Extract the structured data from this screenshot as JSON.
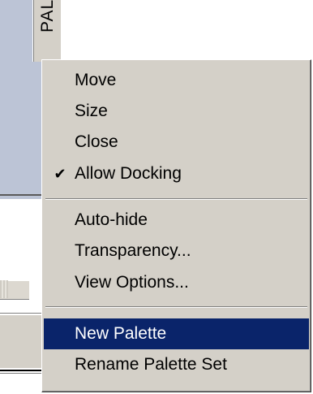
{
  "palette": {
    "title": "PALI"
  },
  "menu": {
    "items": [
      {
        "label": "Move"
      },
      {
        "label": "Size"
      },
      {
        "label": "Close"
      },
      {
        "label": "Allow Docking",
        "checked": true,
        "check_icon": "checkmark-icon"
      },
      {
        "label": "Auto-hide"
      },
      {
        "label": "Transparency..."
      },
      {
        "label": "View Options..."
      },
      {
        "label": "New Palette",
        "highlighted": true
      },
      {
        "label": "Rename Palette Set"
      }
    ]
  },
  "colors": {
    "menu_background": "#d4d0c8",
    "highlight_background": "#0a246a",
    "highlight_text": "#ffffff",
    "panel_background": "#bcc4d6"
  }
}
